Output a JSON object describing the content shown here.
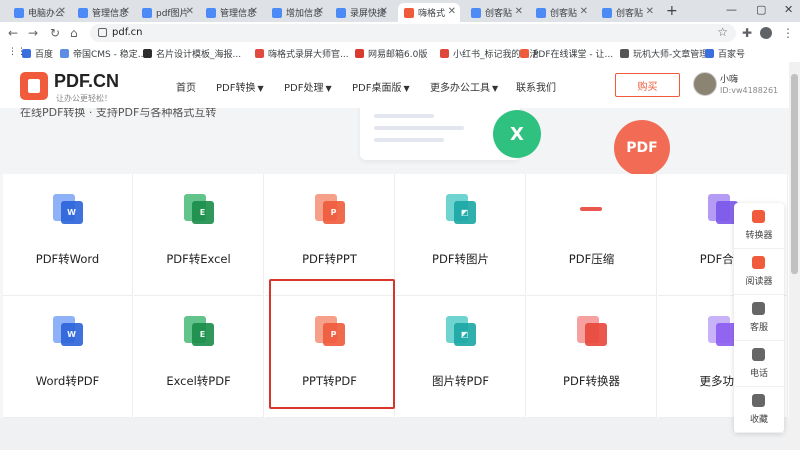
{
  "browser": {
    "tabs": [
      {
        "title": "电脑办公",
        "favicon_color": "#4c8bf5"
      },
      {
        "title": "管理信息",
        "favicon_color": "#4c8bf5"
      },
      {
        "title": "pdf图片",
        "favicon_color": "#4c8bf5"
      },
      {
        "title": "管理信息",
        "favicon_color": "#4c8bf5"
      },
      {
        "title": "增加信息",
        "favicon_color": "#4c8bf5"
      },
      {
        "title": "录屏快捷",
        "favicon_color": "#4c8bf5"
      },
      {
        "title": "嗨格式",
        "favicon_color": "#ef5b3b"
      },
      {
        "title": "创客贴",
        "favicon_color": "#4c8bf5"
      },
      {
        "title": "创客贴",
        "favicon_color": "#4c8bf5"
      },
      {
        "title": "创客贴",
        "favicon_color": "#4c8bf5"
      }
    ],
    "url": "pdf.cn",
    "bookmarks": [
      {
        "label": "百度",
        "color": "#3b6fe0"
      },
      {
        "label": "帝国CMS - 稳定...",
        "color": "#5c8ee6"
      },
      {
        "label": "名片设计模板_海报...",
        "color": "#2d2d2d"
      },
      {
        "label": "嗨格式录屏大师官...",
        "color": "#e04a3f"
      },
      {
        "label": "网易邮箱6.0版",
        "color": "#d93b2f"
      },
      {
        "label": "小红书_标记我的生活",
        "color": "#e0463a"
      },
      {
        "label": "PDF在线课堂 - 让...",
        "color": "#ef5b3b"
      },
      {
        "label": "玩机大师-文章管理",
        "color": "#555555"
      },
      {
        "label": "百家号",
        "color": "#3b6fe0"
      }
    ]
  },
  "site": {
    "logo_text": "PDF.CN",
    "logo_sub": "让办公更轻松！",
    "nav": [
      {
        "label": "首页",
        "dropdown": false
      },
      {
        "label": "PDF转换",
        "dropdown": true
      },
      {
        "label": "PDF处理",
        "dropdown": true
      },
      {
        "label": "PDF桌面版",
        "dropdown": true
      },
      {
        "label": "更多办公工具",
        "dropdown": true
      },
      {
        "label": "联系我们",
        "dropdown": false
      }
    ],
    "buy_label": "购买",
    "user_name": "小嗨",
    "user_id": "ID:vw4188261"
  },
  "banner": {
    "text": "在线PDF转换 · 支持PDF与各种格式互转",
    "badge_x": "X",
    "badge_pdf": "PDF"
  },
  "tools": {
    "row1": [
      {
        "label": "PDF转Word",
        "glyph": "W",
        "c1": "#8fb1f7",
        "c2": "#2b63d9",
        "icon": "word-file-icon"
      },
      {
        "label": "PDF转Excel",
        "glyph": "E",
        "c1": "#62c48a",
        "c2": "#1a8d49",
        "icon": "excel-file-icon"
      },
      {
        "label": "PDF转PPT",
        "glyph": "P",
        "c1": "#f7a089",
        "c2": "#ef5b3b",
        "icon": "ppt-file-icon"
      },
      {
        "label": "PDF转图片",
        "glyph": "◩",
        "c1": "#6fd3cf",
        "c2": "#1aa7a4",
        "icon": "image-file-icon"
      },
      {
        "label": "PDF压缩",
        "glyph": "",
        "c1": "#ffffff",
        "c2": "#e8463a",
        "icon": "compress-icon"
      },
      {
        "label": "PDF合并",
        "glyph": "",
        "c1": "#b49cf5",
        "c2": "#7b56ea",
        "icon": "merge-icon"
      }
    ],
    "row2": [
      {
        "label": "Word转PDF",
        "glyph": "W",
        "c1": "#8fb1f7",
        "c2": "#2b63d9",
        "icon": "word-file-icon"
      },
      {
        "label": "Excel转PDF",
        "glyph": "E",
        "c1": "#62c48a",
        "c2": "#1a8d49",
        "icon": "excel-file-icon"
      },
      {
        "label": "PPT转PDF",
        "glyph": "P",
        "c1": "#f7a089",
        "c2": "#ef5b3b",
        "icon": "ppt-file-icon"
      },
      {
        "label": "图片转PDF",
        "glyph": "◩",
        "c1": "#6fd3cf",
        "c2": "#1aa7a4",
        "icon": "image-file-icon"
      },
      {
        "label": "PDF转换器",
        "glyph": "",
        "c1": "#f7a0a0",
        "c2": "#e8463a",
        "icon": "converter-icon"
      },
      {
        "label": "更多功能",
        "glyph": "",
        "c1": "#c9b3f8",
        "c2": "#8b5cf0",
        "icon": "grid-icon"
      }
    ]
  },
  "sidebar": [
    {
      "label": "转换器",
      "icon": "converter-icon",
      "color": "#ef5b3b"
    },
    {
      "label": "阅读器",
      "icon": "reader-icon",
      "color": "#ef5b3b"
    },
    {
      "label": "客服",
      "icon": "service-icon",
      "color": "#666666"
    },
    {
      "label": "电话",
      "icon": "phone-icon",
      "color": "#666666"
    },
    {
      "label": "收藏",
      "icon": "star-icon",
      "color": "#666666"
    }
  ]
}
